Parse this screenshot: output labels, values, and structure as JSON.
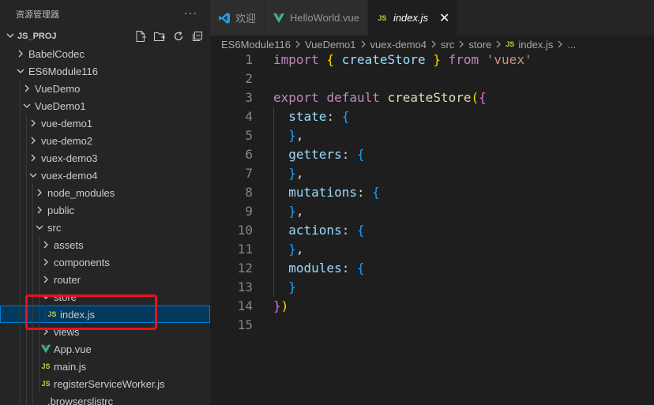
{
  "sidebar": {
    "title": "资源管理器",
    "more": "···",
    "project": "JS_PROJ",
    "tree": [
      {
        "label": "BabelCodec",
        "depth": 0,
        "kind": "folder",
        "open": false
      },
      {
        "label": "ES6Module116",
        "depth": 0,
        "kind": "folder",
        "open": true
      },
      {
        "label": "VueDemo",
        "depth": 1,
        "kind": "folder",
        "open": false
      },
      {
        "label": "VueDemo1",
        "depth": 1,
        "kind": "folder",
        "open": true
      },
      {
        "label": "vue-demo1",
        "depth": 2,
        "kind": "folder",
        "open": false
      },
      {
        "label": "vue-demo2",
        "depth": 2,
        "kind": "folder",
        "open": false
      },
      {
        "label": "vuex-demo3",
        "depth": 2,
        "kind": "folder",
        "open": false
      },
      {
        "label": "vuex-demo4",
        "depth": 2,
        "kind": "folder",
        "open": true
      },
      {
        "label": "node_modules",
        "depth": 3,
        "kind": "folder",
        "open": false
      },
      {
        "label": "public",
        "depth": 3,
        "kind": "folder",
        "open": false
      },
      {
        "label": "src",
        "depth": 3,
        "kind": "folder",
        "open": true
      },
      {
        "label": "assets",
        "depth": 4,
        "kind": "folder",
        "open": false
      },
      {
        "label": "components",
        "depth": 4,
        "kind": "folder",
        "open": false
      },
      {
        "label": "router",
        "depth": 4,
        "kind": "folder",
        "open": false
      },
      {
        "label": "store",
        "depth": 4,
        "kind": "folder",
        "open": true
      },
      {
        "label": "index.js",
        "depth": 5,
        "kind": "js",
        "selected": true
      },
      {
        "label": "views",
        "depth": 4,
        "kind": "folder",
        "open": false
      },
      {
        "label": "App.vue",
        "depth": 4,
        "kind": "vue"
      },
      {
        "label": "main.js",
        "depth": 4,
        "kind": "js"
      },
      {
        "label": "registerServiceWorker.js",
        "depth": 4,
        "kind": "js"
      },
      {
        "label": ".browserslistrc",
        "depth": 3,
        "kind": "file"
      }
    ]
  },
  "tabs": [
    {
      "label": "欢迎",
      "icon": "vscode-icon",
      "active": false
    },
    {
      "label": "HelloWorld.vue",
      "icon": "vue-icon",
      "active": false
    },
    {
      "label": "index.js",
      "icon": "js-icon",
      "active": true
    }
  ],
  "js_badge": "JS",
  "close_glyph": "✕",
  "breadcrumb": [
    "ES6Module116",
    "VueDemo1",
    "vuex-demo4",
    "src",
    "store",
    "index.js",
    "..."
  ],
  "code": {
    "lines": [
      "1",
      "2",
      "3",
      "4",
      "5",
      "6",
      "7",
      "8",
      "9",
      "10",
      "11",
      "12",
      "13",
      "14",
      "15"
    ]
  },
  "colors": {
    "accent": "#007fd4",
    "selection": "#04395e",
    "highlight_box": "#e81123",
    "vue_green": "#41b883",
    "js_yellow": "#cbcb41"
  }
}
